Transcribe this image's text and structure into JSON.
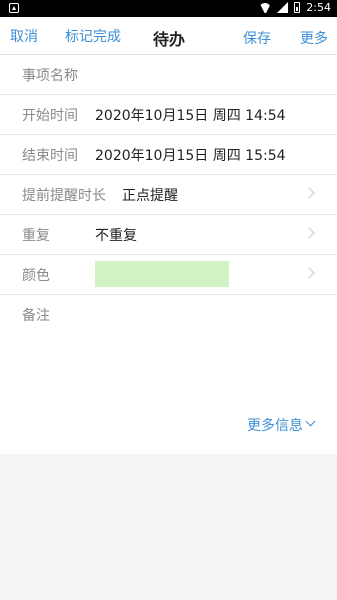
{
  "status_bar": {
    "time": "2:54"
  },
  "toolbar": {
    "cancel": "取消",
    "mark_done": "标记完成",
    "title": "待办",
    "save": "保存",
    "more": "更多"
  },
  "form": {
    "name_placeholder": "事项名称",
    "start_label": "开始时间",
    "start_value": "2020年10月15日 周四 14:54",
    "end_label": "结束时间",
    "end_value": "2020年10月15日 周四 15:54",
    "reminder_label": "提前提醒时长",
    "reminder_value": "正点提醒",
    "repeat_label": "重复",
    "repeat_value": "不重复",
    "color_label": "颜色",
    "color_value": "#d0f3c4",
    "notes_label": "备注",
    "more_info": "更多信息"
  }
}
